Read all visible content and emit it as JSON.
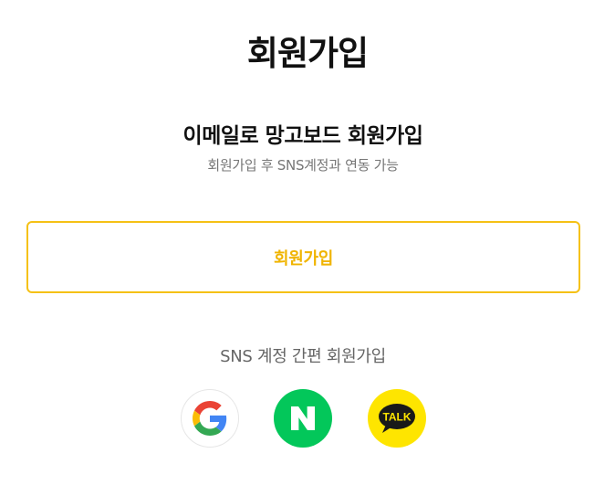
{
  "page": {
    "title": "회원가입"
  },
  "email_section": {
    "heading": "이메일로 망고보드 회원가입",
    "subtext": "회원가입 후 SNS계정과 연동 가능",
    "signup_button_label": "회원가입"
  },
  "sns_section": {
    "title": "SNS 계정 간편 회원가입",
    "providers": [
      {
        "name": "google",
        "icon": "google-g-icon"
      },
      {
        "name": "naver",
        "icon": "naver-n-icon"
      },
      {
        "name": "kakao",
        "icon": "kakao-talk-icon",
        "label": "TALK"
      }
    ]
  },
  "colors": {
    "accent": "#f5c116",
    "accent_text": "#f0b400",
    "naver": "#03c75a",
    "kakao": "#fee500",
    "kakao_bubble": "#191919",
    "google_blue": "#4285F4",
    "google_red": "#EA4335",
    "google_yellow": "#FBBC05",
    "google_green": "#34A853"
  }
}
